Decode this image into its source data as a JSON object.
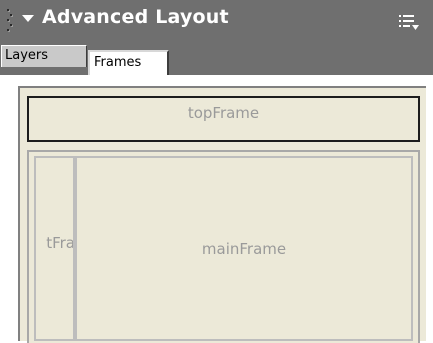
{
  "panel": {
    "title": "Advanced Layout",
    "expander_icon": "triangle-down-icon",
    "options_icon": "panel-options-menu-icon",
    "header_color": "#6f6f6f"
  },
  "tabs": [
    {
      "label": "Layers",
      "selected": false
    },
    {
      "label": "Frames",
      "selected": true
    }
  ],
  "frames": {
    "top": {
      "label": "topFrame"
    },
    "left": {
      "label": "tFra"
    },
    "main": {
      "label": "mainFrame"
    },
    "canvas_color": "#ece9d8"
  }
}
